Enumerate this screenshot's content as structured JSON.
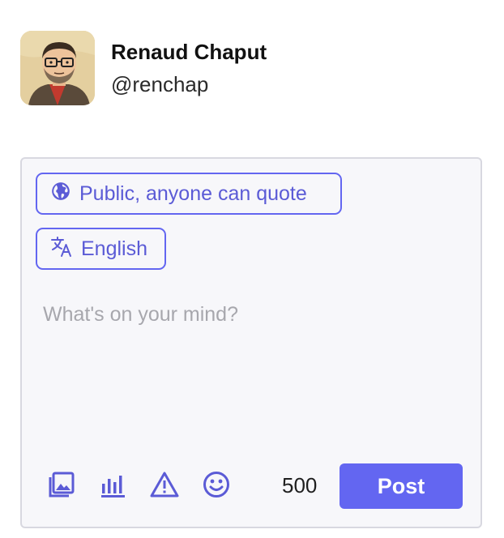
{
  "account": {
    "display_name": "Renaud Chaput",
    "handle": "@renchap"
  },
  "composer": {
    "visibility_label": "Public, anyone can quote",
    "language_label": "English",
    "placeholder": "What's on your mind?",
    "char_counter": "500",
    "post_label": "Post"
  },
  "icons": {
    "visibility": "globe-icon",
    "language": "translate-icon",
    "media": "image-icon",
    "poll": "bar-chart-icon",
    "content_warning": "warning-icon",
    "emoji": "smiley-icon"
  },
  "colors": {
    "accent": "#6366f1",
    "composer_bg": "#f7f7fa",
    "placeholder": "#a7a7ad"
  }
}
